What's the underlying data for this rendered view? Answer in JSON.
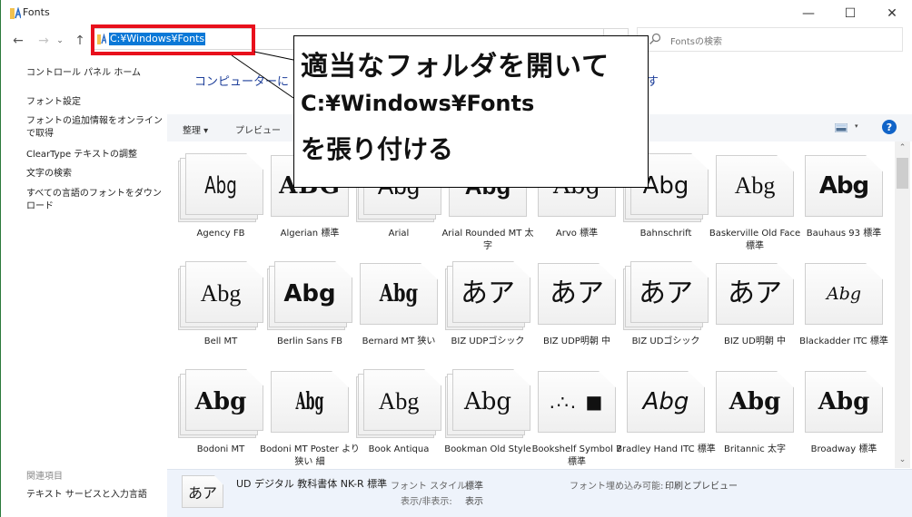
{
  "window": {
    "title": "Fonts",
    "controls": {
      "minimize": "—",
      "maximize": "☐",
      "close": "✕"
    }
  },
  "navigation": {
    "back_icon": "←",
    "forward_icon": "→",
    "recent_icon": "⌄",
    "up_icon": "↑",
    "address": "C:¥Windows¥Fonts",
    "search_placeholder": "Fontsの検索"
  },
  "sidebar": {
    "items": [
      {
        "label": "コントロール パネル ホーム"
      },
      {
        "label": "フォント設定"
      },
      {
        "label": "フォントの追加情報をオンラインで取得"
      },
      {
        "label": "ClearType テキストの調整"
      },
      {
        "label": "文字の検索"
      },
      {
        "label": "すべての言語のフォントをダウンロード"
      }
    ],
    "related_label": "関連項目",
    "related_items": [
      {
        "label": "テキスト サービスと入力言語"
      }
    ]
  },
  "content": {
    "heading_link": "コンピューターに",
    "heading_link_tail": "す",
    "toolbar": {
      "organize": "整理 ▾",
      "preview": "プレビュー",
      "view_arrow": "▾",
      "help": "?"
    },
    "fonts": [
      {
        "name": "Agency FB",
        "sample": "Abg",
        "stack": true
      },
      {
        "name": "Algerian 標準",
        "sample": "ABG",
        "stack": false
      },
      {
        "name": "Arial",
        "sample": "Abg",
        "stack": true
      },
      {
        "name": "Arial Rounded MT 太字",
        "sample": "Abg",
        "stack": false
      },
      {
        "name": "Arvo 標準",
        "sample": "Abg",
        "stack": false
      },
      {
        "name": "Bahnschrift",
        "sample": "Abg",
        "stack": true
      },
      {
        "name": "Baskerville Old Face 標準",
        "sample": "Abg",
        "stack": false
      },
      {
        "name": "Bauhaus 93 標準",
        "sample": "Abg",
        "stack": false
      },
      {
        "name": "Bell MT",
        "sample": "Abg",
        "stack": true
      },
      {
        "name": "Berlin Sans FB",
        "sample": "Abg",
        "stack": true
      },
      {
        "name": "Bernard MT 狭い",
        "sample": "Abg",
        "stack": false
      },
      {
        "name": "BIZ UDPゴシック",
        "sample": "あア",
        "stack": true
      },
      {
        "name": "BIZ UDP明朝 中",
        "sample": "あア",
        "stack": false
      },
      {
        "name": "BIZ UDゴシック",
        "sample": "あア",
        "stack": true
      },
      {
        "name": "BIZ UD明朝 中",
        "sample": "あア",
        "stack": false
      },
      {
        "name": "Blackadder ITC 標準",
        "sample": "Abg",
        "stack": false
      },
      {
        "name": "Bodoni MT",
        "sample": "Abg",
        "stack": true
      },
      {
        "name": "Bodoni MT Poster より狭い 細",
        "sample": "Abg",
        "stack": false
      },
      {
        "name": "Book Antiqua",
        "sample": "Abg",
        "stack": true
      },
      {
        "name": "Bookman Old Style",
        "sample": "Abg",
        "stack": true
      },
      {
        "name": "Bookshelf Symbol 7 標準",
        "sample": ".∴. ■",
        "stack": false
      },
      {
        "name": "Bradley Hand ITC 標準",
        "sample": "Abg",
        "stack": false
      },
      {
        "name": "Britannic 太字",
        "sample": "Abg",
        "stack": false
      },
      {
        "name": "Broadway 標準",
        "sample": "Abg",
        "stack": false
      }
    ],
    "details": {
      "sample": "あア",
      "name": "UD デジタル 教科書体 NK-R 標準",
      "style_key": "フォント スタイル:",
      "style_val": "標準",
      "visibility_key": "表示/非表示:",
      "visibility_val": "表示",
      "embed_key": "フォント埋め込み可能:",
      "embed_val": "印刷とプレビュー"
    }
  },
  "annotation": {
    "line1": "適当なフォルダを開いて",
    "line2": "C:¥Windows¥Fonts",
    "line3": "を張り付ける",
    "highlight_color": "#e8101c"
  }
}
